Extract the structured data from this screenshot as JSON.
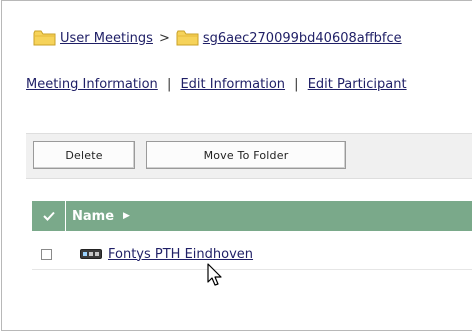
{
  "breadcrumb": {
    "items": [
      {
        "label": "User Meetings",
        "icon": "folder-icon"
      },
      {
        "label": "sg6aec270099bd40608affbfce",
        "icon": "folder-icon"
      }
    ],
    "separator": ">"
  },
  "tabs": {
    "items": [
      {
        "label": "Meeting Information"
      },
      {
        "label": "Edit Information"
      },
      {
        "label": "Edit Participant"
      }
    ],
    "separator": "|"
  },
  "toolbar": {
    "delete_label": "Delete",
    "move_label": "Move To Folder"
  },
  "table": {
    "header": {
      "name_label": "Name",
      "sort_icon": "arrow-right-icon",
      "select_all_icon": "checkmark-icon"
    },
    "rows": [
      {
        "name": "Fontys PTH Eindhoven",
        "icon": "meeting-icon"
      }
    ]
  },
  "colors": {
    "header_bg": "#7aa98a",
    "link": "#1f1f66",
    "toolbar_bg": "#f0f0f0",
    "folder": "#f2c94c"
  }
}
